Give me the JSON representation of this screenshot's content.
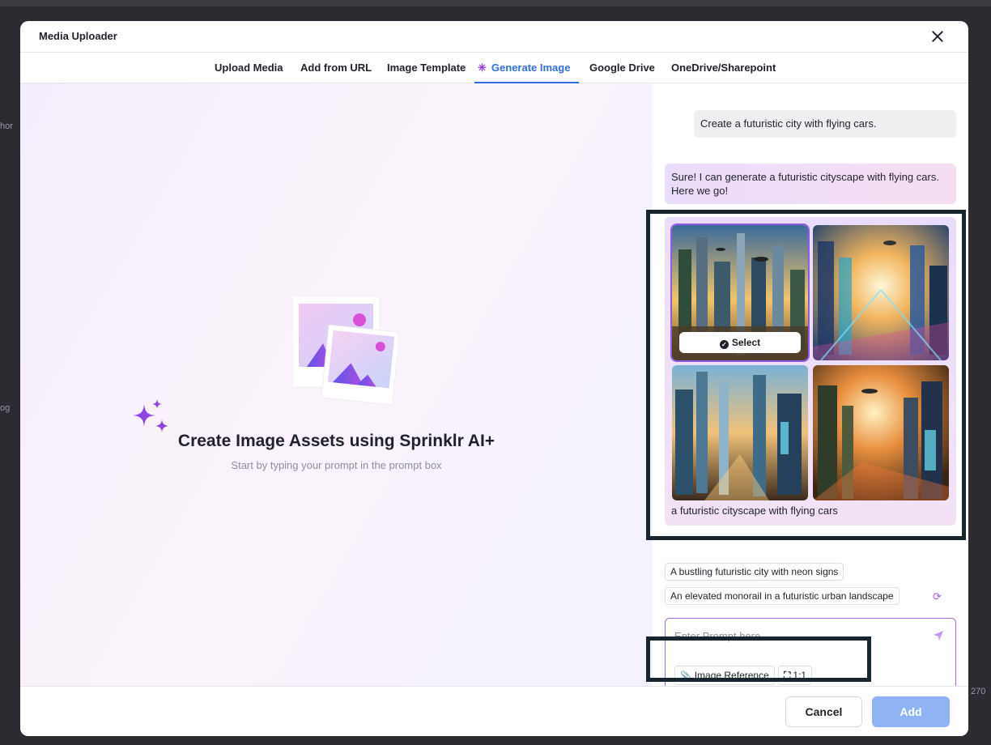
{
  "modal": {
    "title": "Media Uploader"
  },
  "tabs": [
    {
      "label": "Upload Media"
    },
    {
      "label": "Add from URL"
    },
    {
      "label": "Image Template"
    },
    {
      "label": "Generate Image",
      "active": true,
      "icon": "sparkle-icon"
    },
    {
      "label": "Google Drive"
    },
    {
      "label": "OneDrive/Sharepoint"
    }
  ],
  "empty_state": {
    "headline": "Create Image Assets using Sprinklr AI+",
    "subline": "Start by typing your prompt in the prompt box"
  },
  "chat": {
    "user_message": "Create a futuristic city with flying cars.",
    "assistant_message": "Sure! I can generate a futuristic cityscape with flying cars. Here we go!",
    "result": {
      "select_label": "Select",
      "caption": "a futuristic cityscape with flying cars",
      "image_count": 4
    },
    "suggestions": [
      "A bustling futuristic city with neon signs",
      "An elevated monorail in a futuristic urban landscape"
    ]
  },
  "prompt": {
    "placeholder": "Enter Prompt here...",
    "value": "",
    "image_reference_label": "Image Reference",
    "aspect_ratio_label": "1:1"
  },
  "footer": {
    "cancel_label": "Cancel",
    "add_label": "Add"
  },
  "colors": {
    "accent": "#2f6fe0",
    "ai_purple": "#9b3dde",
    "add_disabled": "#8fb3f5",
    "highlight_outline": "#17262e"
  }
}
